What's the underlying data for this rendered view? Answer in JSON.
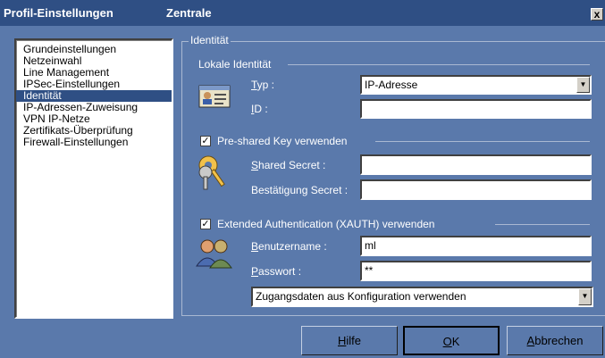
{
  "window": {
    "title_left": "Profil-Einstellungen",
    "title_right": "Zentrale",
    "close_glyph": "x"
  },
  "nav": {
    "items": [
      {
        "label": "Grundeinstellungen",
        "selected": false
      },
      {
        "label": "Netzeinwahl",
        "selected": false
      },
      {
        "label": "Line Management",
        "selected": false
      },
      {
        "label": "IPSec-Einstellungen",
        "selected": false
      },
      {
        "label": "Identität",
        "selected": true
      },
      {
        "label": "IP-Adressen-Zuweisung",
        "selected": false
      },
      {
        "label": "VPN IP-Netze",
        "selected": false
      },
      {
        "label": "Zertifikats-Überprüfung",
        "selected": false
      },
      {
        "label": "Firewall-Einstellungen",
        "selected": false
      }
    ]
  },
  "identity": {
    "group_title": "Identität",
    "local_section": "Lokale Identität",
    "type_label_ul": "T",
    "type_label_rest": "yp :",
    "type_value": "IP-Adresse",
    "id_label_ul": "I",
    "id_label_rest": "D :",
    "id_value": "",
    "psk_checkbox_label": "Pre-shared Key verwenden",
    "psk_checked": true,
    "shared_secret_label_ul": "S",
    "shared_secret_label_rest": "hared Secret :",
    "shared_secret_value": "",
    "confirm_secret_label": "Bestätigung Secret :",
    "confirm_secret_value": "",
    "xauth_checkbox_label": "Extended Authentication (XAUTH) verwenden",
    "xauth_checked": true,
    "username_label_ul": "B",
    "username_label_rest": "enutzername :",
    "username_value": "ml",
    "password_label_ul": "P",
    "password_label_rest": "asswort :",
    "password_value": "**",
    "credentials_source_value": "Zugangsdaten aus Konfiguration verwenden"
  },
  "buttons": {
    "help_ul": "H",
    "help_rest": "ilfe",
    "ok_ul": "O",
    "ok_rest": "K",
    "cancel_ul": "A",
    "cancel_rest": "bbrechen"
  },
  "colors": {
    "dialog_bg": "#5a79ab",
    "title_bg": "#2f4f84",
    "selection_bg": "#2f4f84"
  },
  "icons": {
    "local_identity": "id-card-icon",
    "shared_secret": "keys-icon",
    "xauth": "users-icon",
    "combo_arrow": "chevron-down-icon"
  }
}
